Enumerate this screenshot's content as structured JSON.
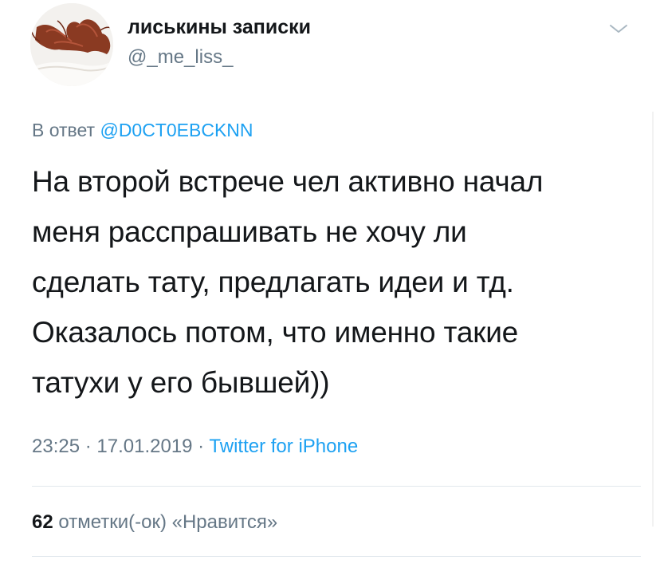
{
  "author": {
    "display_name": "лиськины записки",
    "handle": "@_me_liss_"
  },
  "reply": {
    "prefix": "В ответ",
    "to": "@D0CT0EBCKNN"
  },
  "tweet": {
    "lines": [
      "На второй встрече чел активно начал",
      "меня расспрашивать не хочу ли",
      "сделать тату, предлагать идеи и тд.",
      "Оказалось потом, что именно такие",
      "татухи у его бывшей))"
    ]
  },
  "meta": {
    "time": "23:25",
    "separator": " · ",
    "date": "17.01.2019",
    "source": "Twitter for iPhone"
  },
  "stats": {
    "likes_count": "62",
    "likes_label": "отметки(-ок) «Нравится»"
  },
  "icons": {
    "menu": "chevron-down-icon"
  },
  "colors": {
    "text": "#14171a",
    "secondary": "#657786",
    "link": "#1da1f2",
    "divider": "#e1e8ed"
  }
}
